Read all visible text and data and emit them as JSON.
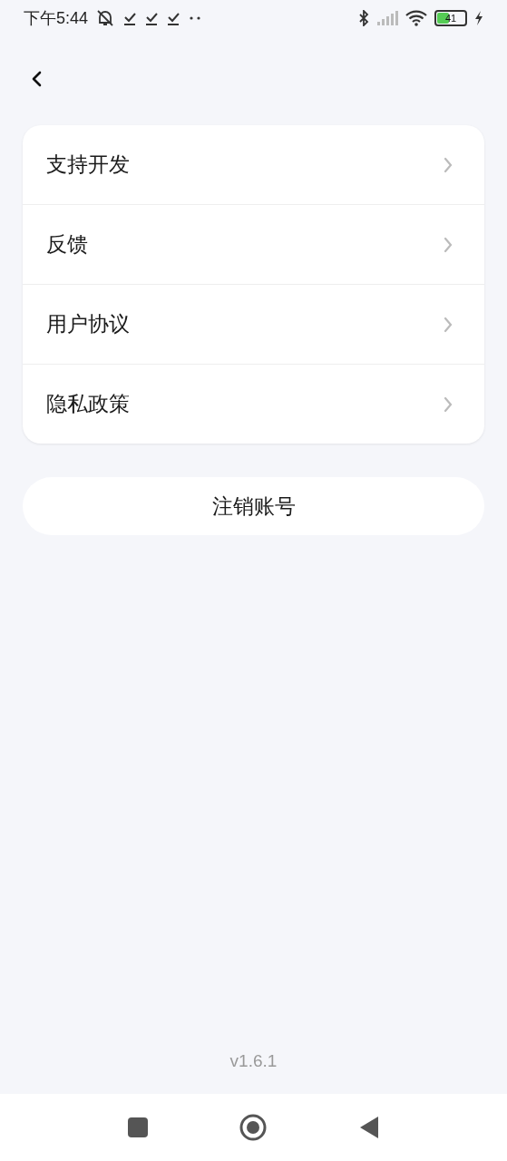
{
  "status_bar": {
    "time": "下午5:44",
    "battery": "41"
  },
  "menu": [
    {
      "label": "支持开发"
    },
    {
      "label": "反馈"
    },
    {
      "label": "用户协议"
    },
    {
      "label": "隐私政策"
    }
  ],
  "logout_button": "注销账号",
  "version": "v1.6.1"
}
